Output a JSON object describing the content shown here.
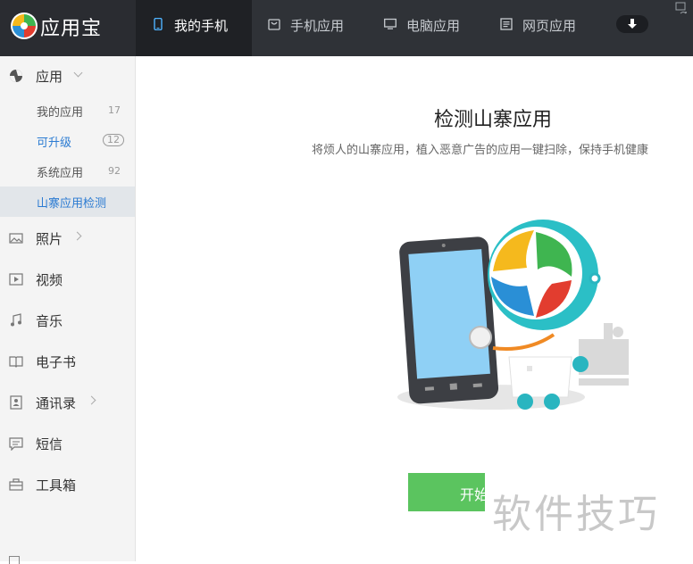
{
  "brand": {
    "name": "应用宝"
  },
  "tabs": [
    {
      "label": "我的手机",
      "icon": "phone-icon",
      "active": true
    },
    {
      "label": "手机应用",
      "icon": "bag-icon",
      "active": false
    },
    {
      "label": "电脑应用",
      "icon": "monitor-icon",
      "active": false
    },
    {
      "label": "网页应用",
      "icon": "webpage-icon",
      "active": false
    }
  ],
  "sidebar": {
    "apps": {
      "label": "应用",
      "icon": "apps-icon"
    },
    "app_sub": [
      {
        "label": "我的应用",
        "count": "17"
      },
      {
        "label": "可升级",
        "count": "12"
      },
      {
        "label": "系统应用",
        "count": "92"
      },
      {
        "label": "山寨应用检测",
        "count": ""
      }
    ],
    "items": [
      {
        "label": "照片",
        "icon": "photo-icon"
      },
      {
        "label": "视频",
        "icon": "video-icon"
      },
      {
        "label": "音乐",
        "icon": "music-icon"
      },
      {
        "label": "电子书",
        "icon": "book-icon"
      },
      {
        "label": "通讯录",
        "icon": "contacts-icon"
      },
      {
        "label": "短信",
        "icon": "message-icon"
      },
      {
        "label": "工具箱",
        "icon": "toolbox-icon"
      }
    ]
  },
  "main": {
    "title": "检测山寨应用",
    "description": "将烦人的山寨应用，植入恶意广告的应用一键扫除，保持手机健康",
    "start_button": "开始"
  },
  "watermark": "软件技巧",
  "colors": {
    "accent": "#2b7bd2",
    "start_button": "#5bc45f",
    "topbar": "#2f3237"
  }
}
